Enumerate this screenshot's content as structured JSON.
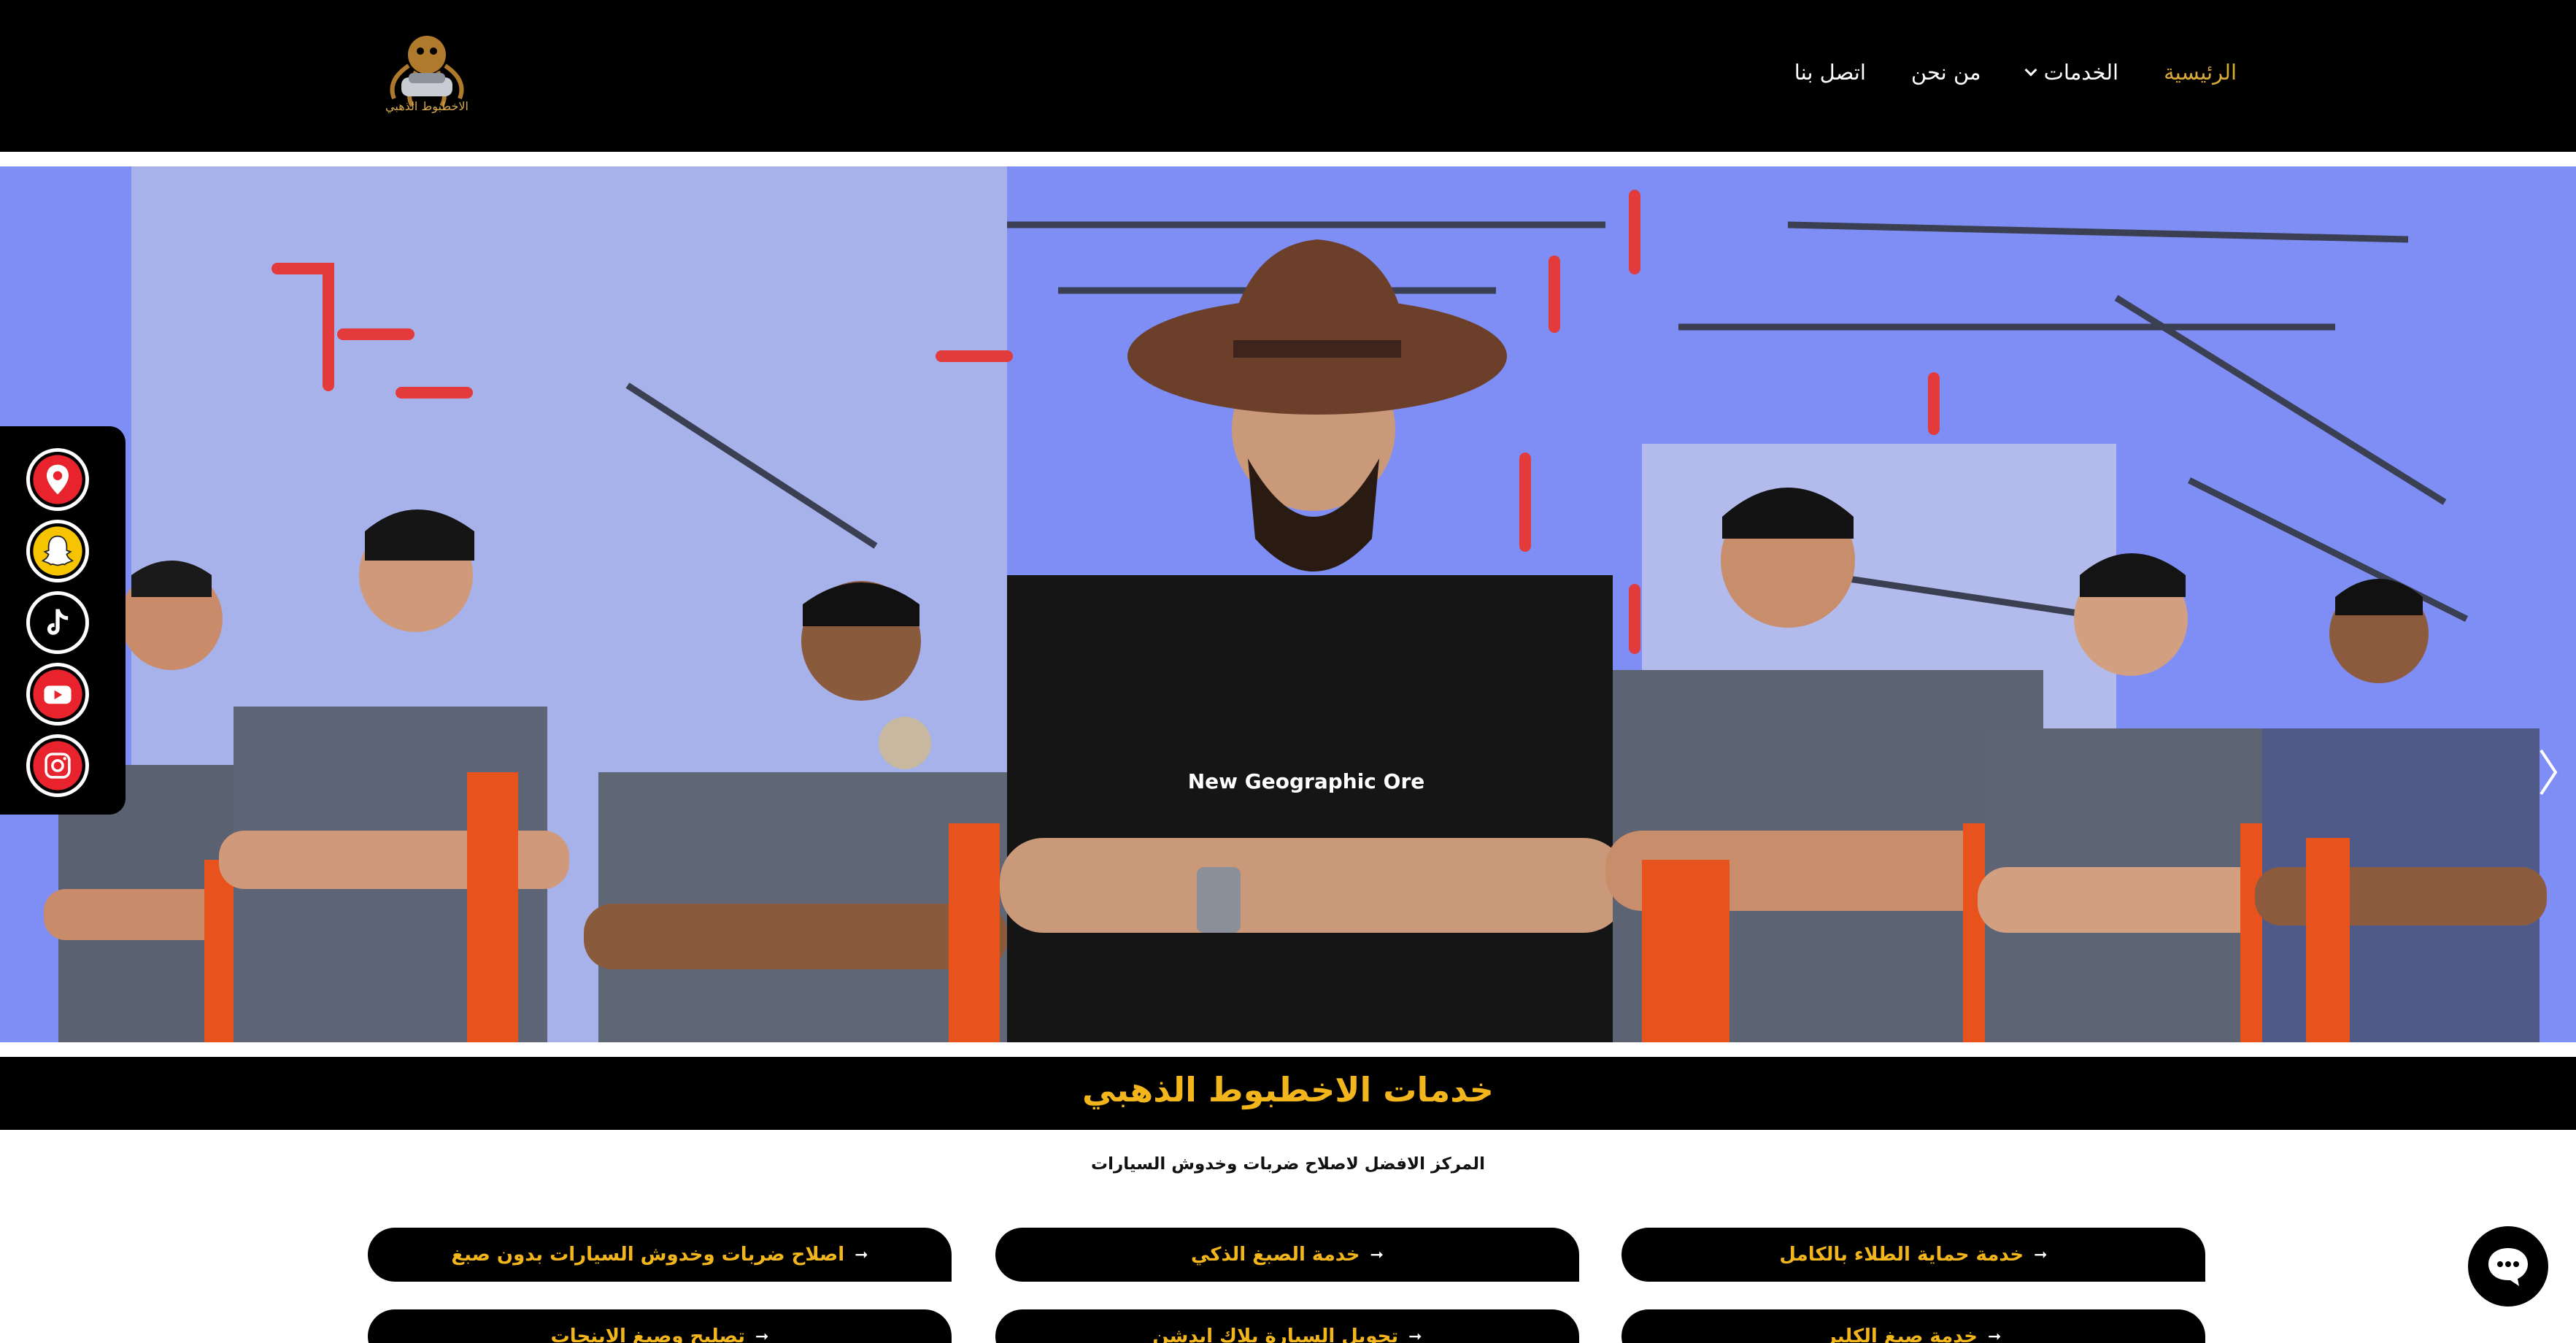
{
  "header": {
    "logo_text": "الاخطبوط الذهبي",
    "nav": [
      {
        "label": "الرئيسية",
        "active": true
      },
      {
        "label": "الخدمات",
        "has_dropdown": true
      },
      {
        "label": "من نحن"
      },
      {
        "label": "اتصل بنا"
      }
    ]
  },
  "hero": {
    "shirt_text": "New Geographic Ore",
    "next_arrow_icon": "chevron-right-icon"
  },
  "social": [
    {
      "icon": "map-pin-icon",
      "color": "#e8232d"
    },
    {
      "icon": "snapchat-icon",
      "color": "#f6c400"
    },
    {
      "icon": "tiktok-icon",
      "color": "#000000"
    },
    {
      "icon": "youtube-icon",
      "color": "#e8232d"
    },
    {
      "icon": "instagram-icon",
      "color": "#e8232d"
    }
  ],
  "section": {
    "title": "خدمات الاخطبوط الذهبي",
    "subtitle": "المركز الافضل لاصلاح ضربات وخدوش السيارات"
  },
  "services": [
    {
      "label": "اصلاح ضربات وخدوش السيارات بدون صبغ"
    },
    {
      "label": "خدمة الصبغ الذكي"
    },
    {
      "label": "خدمة حماية الطلاء بالكامل"
    },
    {
      "label": "تصليح وصبغ الاينجات"
    },
    {
      "label": "تحويل السيارة بلاك ايدشن"
    },
    {
      "label": "خدمة صبغ الكلبر"
    }
  ],
  "colors": {
    "accent": "#f2b51b",
    "nav_active": "#d9a93a",
    "header_bg": "#000000"
  },
  "chat": {
    "icon": "chat-bubble-icon"
  }
}
